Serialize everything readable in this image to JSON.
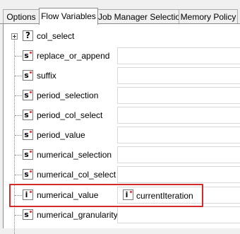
{
  "tabs": [
    {
      "label": "Options",
      "active": false
    },
    {
      "label": "Flow Variables",
      "active": true
    },
    {
      "label": "Job Manager Selection",
      "active": false
    },
    {
      "label": "Memory Policy",
      "active": false
    }
  ],
  "tree": {
    "root": {
      "label": "col_select",
      "icon": "question-mark-icon",
      "glyph": "?"
    },
    "items": [
      {
        "label": "replace_or_append",
        "type_glyph": "s",
        "value": ""
      },
      {
        "label": "suffix",
        "type_glyph": "s",
        "value": ""
      },
      {
        "label": "period_selection",
        "type_glyph": "s",
        "value": ""
      },
      {
        "label": "period_col_select",
        "type_glyph": "s",
        "value": ""
      },
      {
        "label": "period_value",
        "type_glyph": "s",
        "value": ""
      },
      {
        "label": "numerical_selection",
        "type_glyph": "s",
        "value": ""
      },
      {
        "label": "numerical_col_select",
        "type_glyph": "s",
        "value": ""
      },
      {
        "label": "numerical_value",
        "type_glyph": "i",
        "value": "currentIteration",
        "value_glyph": "i",
        "highlighted": true
      },
      {
        "label": "numerical_granularity",
        "type_glyph": "s",
        "value": ""
      }
    ]
  },
  "colors": {
    "highlight": "#d42a2a",
    "type_dot": "#e03030"
  }
}
